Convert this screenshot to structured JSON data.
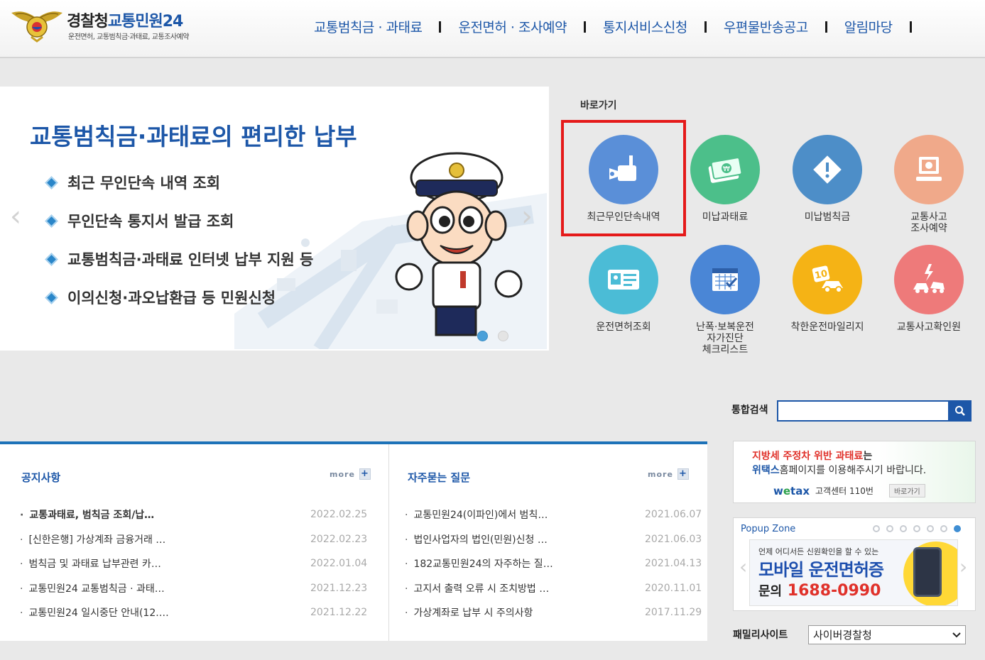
{
  "header": {
    "logo_part1": "경찰청",
    "logo_part2": "교통민원24",
    "logo_sub": "운전면허, 교통범칙금·과태료, 교통조사예약",
    "nav": [
      "교통범칙금 · 과태료",
      "운전면허 · 조사예약",
      "통지서비스신청",
      "우편물반송공고",
      "알림마당"
    ]
  },
  "banner": {
    "title": "교통범칙금·과태료의 편리한 납부",
    "bullets": [
      "최근 무인단속 내역 조회",
      "무인단속 통지서 발급 조회",
      "교통범칙금·과태료 인터넷 납부 지원 등",
      "이의신청·과오납환급 등 민원신청"
    ],
    "arrow_left": "‹",
    "arrow_right": "›"
  },
  "quick": {
    "title": "바로가기",
    "items": [
      {
        "label": "최근무인단속내역",
        "color": "#5a8fd8"
      },
      {
        "label": "미납과태료",
        "color": "#4cbf8a"
      },
      {
        "label": "미납범칙금",
        "color": "#4d8ec8"
      },
      {
        "label": "교통사고\n조사예약",
        "color": "#f0a98a"
      },
      {
        "label": "운전면허조회",
        "color": "#4bbcd6"
      },
      {
        "label": "난폭·보복운전\n자가진단\n체크리스트",
        "color": "#4a86d6"
      },
      {
        "label": "착한운전마일리지",
        "color": "#f5b315"
      },
      {
        "label": "교통사고확인원",
        "color": "#ee7a7a"
      }
    ]
  },
  "search": {
    "label": "통합검색",
    "value": ""
  },
  "notice": {
    "title": "공지사항",
    "more": "more",
    "rows": [
      {
        "text": "교통과태료, 범칙금 조회/납…",
        "date": "2022.02.25"
      },
      {
        "text": "[신한은행] 가상계좌 금융거래 …",
        "date": "2022.02.23"
      },
      {
        "text": "범칙금 및 과태료 납부관련 카…",
        "date": "2022.01.04"
      },
      {
        "text": "교통민원24 교통범칙금 · 과태…",
        "date": "2021.12.23"
      },
      {
        "text": "교통민원24 일시중단 안내(12.…",
        "date": "2021.12.22"
      }
    ]
  },
  "faq": {
    "title": "자주묻는 질문",
    "more": "more",
    "rows": [
      {
        "text": "교통민원24(이파인)에서 범칙…",
        "date": "2021.06.07"
      },
      {
        "text": "법인사업자의 법인(민원)신청 …",
        "date": "2021.06.03"
      },
      {
        "text": "182교통민원24의 자주하는 질…",
        "date": "2021.04.13"
      },
      {
        "text": "고지서 출력 오류 시 조치방법 …",
        "date": "2020.11.01"
      },
      {
        "text": "가상계좌로 납부 시 주의사항",
        "date": "2017.11.29"
      }
    ]
  },
  "wetax": {
    "line1_red": "지방세 주정차 위반 과태료",
    "line1_rest": "는",
    "line2_bold": "위택스",
    "line2_rest": "홈페이지를 이용해주시기 바랍니다.",
    "logo_w": "w",
    "logo_e": "e",
    "logo_tax": "tax",
    "center": "고객센터 110번",
    "go": "바로가기"
  },
  "popup": {
    "title": "Popup Zone",
    "small": "언제 어디서든 신원확인을 할 수 있는",
    "big": "모바일 운전면허증",
    "tel_label": "문의",
    "tel": "1688-0990",
    "page_count": 7
  },
  "family": {
    "label": "패밀리사이트",
    "selected": "사이버경찰청"
  },
  "colors": {
    "brand_blue": "#1d57a8",
    "highlight_red": "#e51a1a"
  }
}
